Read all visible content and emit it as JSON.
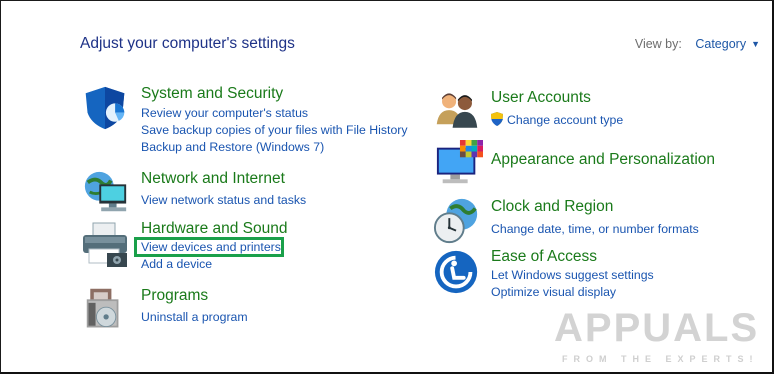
{
  "header": {
    "title": "Adjust your computer's settings",
    "view_by_label": "View by:",
    "view_by_value": "Category"
  },
  "categories": [
    {
      "name": "System and Security",
      "icon": "shield-icon",
      "links": [
        "Review your computer's status",
        "Save backup copies of your files with File History",
        "Backup and Restore (Windows 7)"
      ]
    },
    {
      "name": "Network and Internet",
      "icon": "globe-network-icon",
      "links": [
        "View network status and tasks"
      ]
    },
    {
      "name": "Hardware and Sound",
      "icon": "printer-icon",
      "links": [
        "View devices and printers",
        "Add a device"
      ]
    },
    {
      "name": "Programs",
      "icon": "programs-disc-icon",
      "links": [
        "Uninstall a program"
      ]
    },
    {
      "name": "User Accounts",
      "icon": "users-icon",
      "links": [
        "Change account type"
      ]
    },
    {
      "name": "Appearance and Personalization",
      "icon": "monitor-palette-icon",
      "links": []
    },
    {
      "name": "Clock and Region",
      "icon": "clock-globe-icon",
      "links": [
        "Change date, time, or number formats"
      ]
    },
    {
      "name": "Ease of Access",
      "icon": "ease-of-access-icon",
      "links": [
        "Let Windows suggest settings",
        "Optimize visual display"
      ]
    }
  ],
  "watermark": {
    "text": "APPUALS",
    "subtext": "FROM THE EXPERTS!"
  },
  "colors": {
    "heading": "#1a7a1a",
    "link": "#1a55b0",
    "title": "#1e3287",
    "highlight": "#1aa04a"
  }
}
